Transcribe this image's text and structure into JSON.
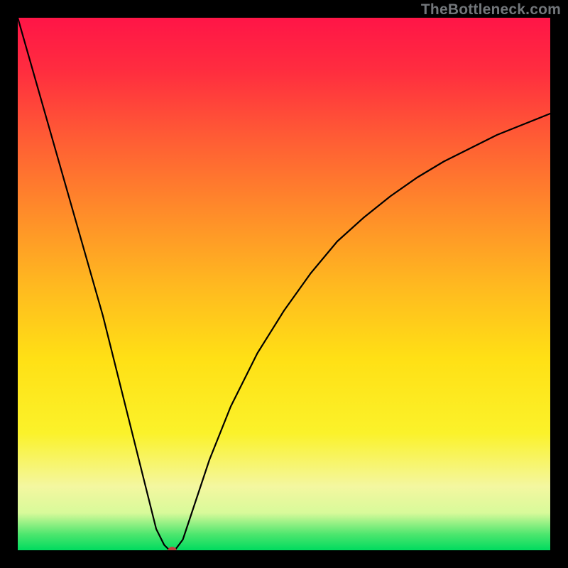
{
  "watermark": "TheBottleneck.com",
  "colors": {
    "frame": "#000000",
    "gradient_top": "#ff1547",
    "gradient_bottom": "#00db5f",
    "curve": "#000000",
    "dot": "#c04040",
    "watermark": "#72767a"
  },
  "chart_data": {
    "type": "line",
    "title": "",
    "xlabel": "",
    "ylabel": "",
    "xlim": [
      0,
      100
    ],
    "ylim": [
      0,
      100
    ],
    "grid": false,
    "x": [
      0,
      2,
      4,
      6,
      8,
      10,
      12,
      14,
      16,
      18,
      20,
      22,
      24,
      26,
      27.5,
      28.5,
      29.5,
      31,
      33,
      36,
      40,
      45,
      50,
      55,
      60,
      65,
      70,
      75,
      80,
      85,
      90,
      95,
      100
    ],
    "values": [
      100,
      93,
      86,
      79,
      72,
      65,
      58,
      51,
      44,
      36,
      28,
      20,
      12,
      4,
      1,
      0,
      0,
      2,
      8,
      17,
      27,
      37,
      45,
      52,
      58,
      62.5,
      66.5,
      70,
      73,
      75.5,
      78,
      80,
      82
    ],
    "minimum_marker": {
      "x": 29,
      "y": 0
    },
    "annotations": [
      "TheBottleneck.com"
    ]
  }
}
